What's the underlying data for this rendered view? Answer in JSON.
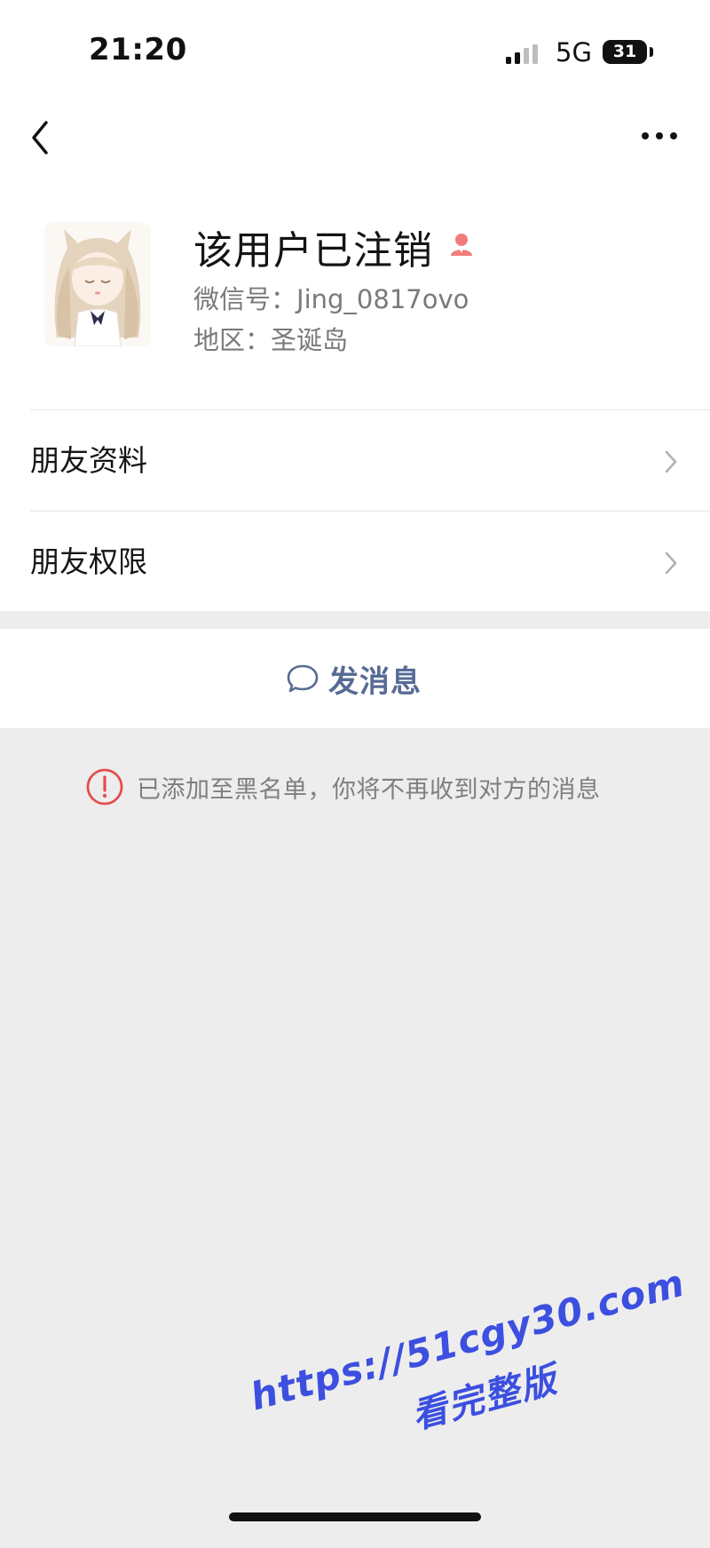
{
  "status_bar": {
    "time": "21:20",
    "network": "5G",
    "battery": "31"
  },
  "header": {
    "back_icon": "chevron-left-icon",
    "more_icon": "ellipsis-icon"
  },
  "profile": {
    "name": "该用户已注销",
    "badge_icon": "person-badge-icon",
    "badge_color": "#f07c7c",
    "wechat_id_label": "微信号：",
    "wechat_id": "Jing_0817ovo",
    "region_label": "地区：",
    "region": "圣诞岛"
  },
  "menu": {
    "items": [
      {
        "label": "朋友资料"
      },
      {
        "label": "朋友权限"
      }
    ]
  },
  "actions": {
    "send_message": "发消息",
    "send_icon": "chat-bubble-icon",
    "accent": "#576b95"
  },
  "notice": {
    "text": "已添加至黑名单，你将不再收到对方的消息",
    "icon": "alert-circle-icon",
    "icon_color": "#e54d4d"
  },
  "watermark": {
    "line1": "https://51cgy30.com",
    "line2": "看完整版"
  }
}
